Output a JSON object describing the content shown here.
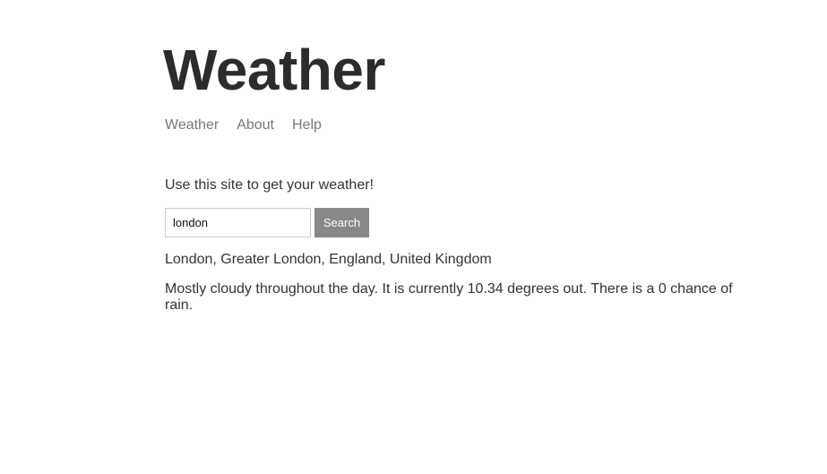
{
  "header": {
    "title": "Weather"
  },
  "nav": {
    "items": [
      {
        "label": "Weather"
      },
      {
        "label": "About"
      },
      {
        "label": "Help"
      }
    ]
  },
  "main": {
    "intro": "Use this site to get your weather!",
    "search": {
      "value": "london",
      "placeholder": "",
      "button_label": "Search"
    },
    "location": "London, Greater London, England, United Kingdom",
    "forecast": "Mostly cloudy throughout the day. It is currently 10.34 degrees out. There is a 0 chance of rain."
  }
}
